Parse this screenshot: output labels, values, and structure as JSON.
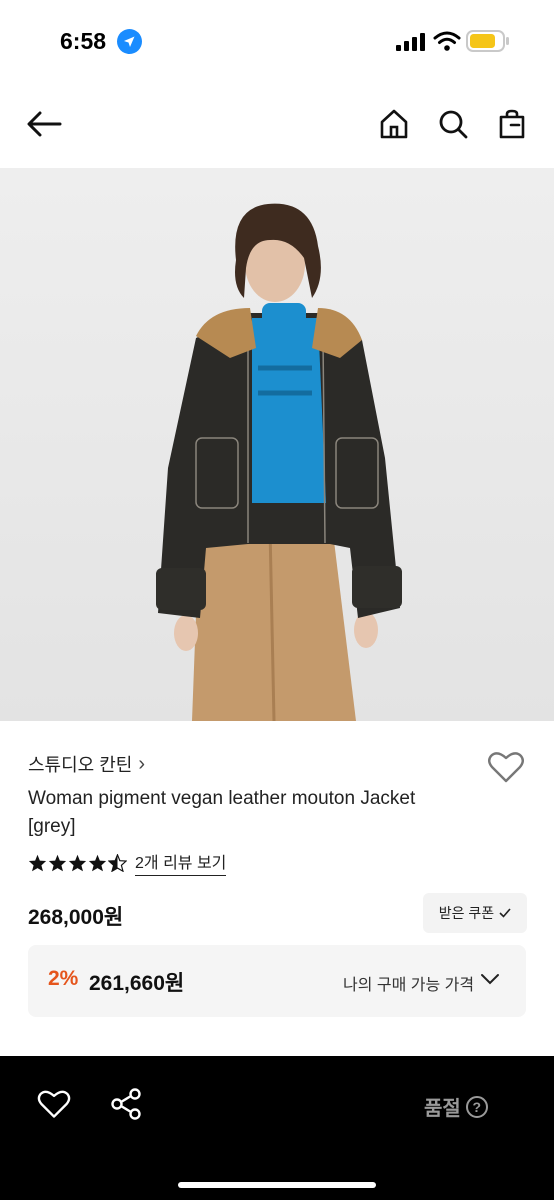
{
  "status": {
    "time": "6:58"
  },
  "nav": {
    "back_icon": "arrow-left-icon",
    "home_icon": "home-icon",
    "search_icon": "search-icon",
    "bag_icon": "shopping-bag-icon"
  },
  "product": {
    "image_alt": "Model wearing black leather mouton jacket with shearling collar, blue turtleneck and camel trousers",
    "brand": "스튜디오 칸틴",
    "brand_chevron": "›",
    "title": "Woman pigment vegan leather mouton Jacket [grey]",
    "rating": 4.5,
    "review_link": "2개 리뷰 보기",
    "price": "268,000원",
    "coupon_button": "받은 쿠폰",
    "my_price": {
      "discount": "2%",
      "price": "261,660원",
      "label": "나의 구매 가능 가격"
    }
  },
  "bottom_bar": {
    "heart_icon": "heart-outline-icon",
    "share_icon": "share-icon",
    "soldout_label": "품절",
    "help_glyph": "?"
  },
  "colors": {
    "accent": "#e5551c",
    "bar": "#000000",
    "muted": "#9a9a9a"
  }
}
